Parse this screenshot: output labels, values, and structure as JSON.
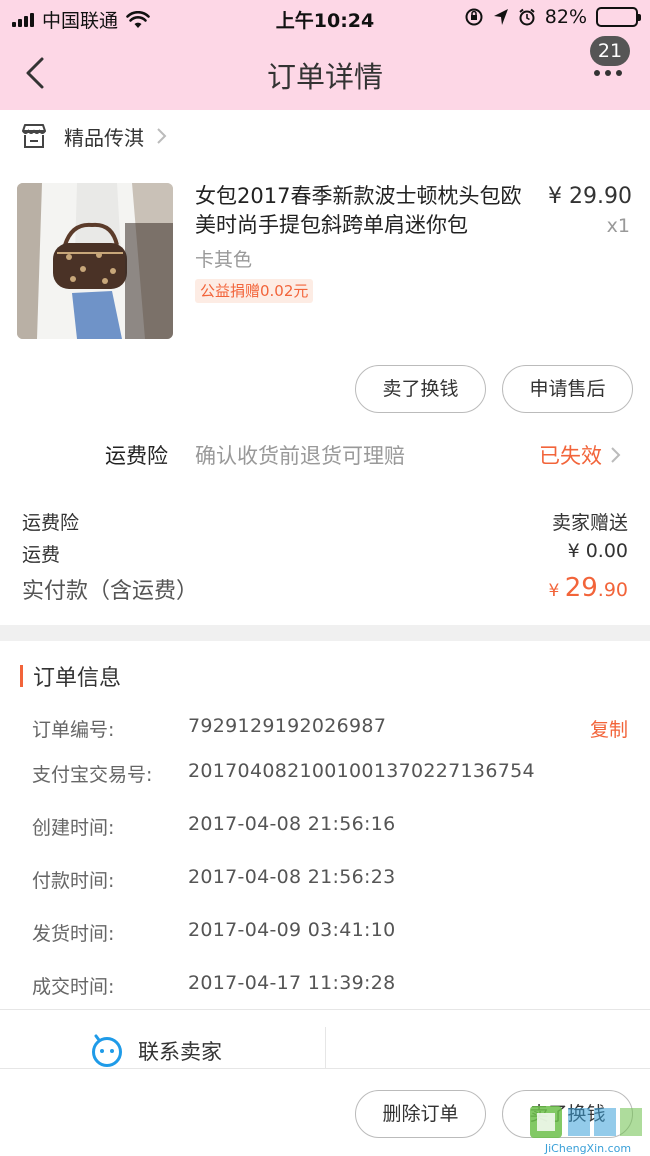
{
  "status_bar": {
    "carrier": "中国联通",
    "time": "上午10:24",
    "battery": "82%",
    "battery_level": 0.82
  },
  "nav": {
    "title": "订单详情",
    "badge": "21"
  },
  "shop": {
    "name": "精品传淇"
  },
  "product": {
    "title": "女包2017春季新款波士顿枕头包欧美时尚手提包斜跨单肩迷你包",
    "price": "¥ 29.90",
    "qty": "x1",
    "sku": "卡其色",
    "tag": "公益捐赠0.02元"
  },
  "actions": {
    "sell": "卖了换钱",
    "after_sale": "申请售后",
    "delete": "删除订单"
  },
  "insurance": {
    "label": "运费险",
    "desc": "确认收货前退货可理赔",
    "status": "已失效"
  },
  "summary": {
    "ins_label": "运费险",
    "ins_value": "卖家赠送",
    "freight_label": "运费",
    "freight_value": "¥ 0.00",
    "paid_label": "实付款（含运费）",
    "paid_currency": "¥ ",
    "paid_int": "29",
    "paid_dec": ".90"
  },
  "order_info": {
    "title": "订单信息",
    "copy": "复制",
    "rows": [
      {
        "key": "订单编号:",
        "value": "7929129192026987"
      },
      {
        "key": "支付宝交易号:",
        "value": "2017040821001001370227136754"
      },
      {
        "key": "创建时间:",
        "value": "2017-04-08 21:56:16"
      },
      {
        "key": "付款时间:",
        "value": "2017-04-08 21:56:23"
      },
      {
        "key": "发货时间:",
        "value": "2017-04-09 03:41:10"
      },
      {
        "key": "成交时间:",
        "value": "2017-04-17 11:39:28"
      }
    ]
  },
  "contact": {
    "label": "联系卖家"
  },
  "watermark": {
    "text": "JiChengXin.com"
  },
  "colors": {
    "header_bg": "#fdd7e6",
    "accent": "#f2643a"
  }
}
